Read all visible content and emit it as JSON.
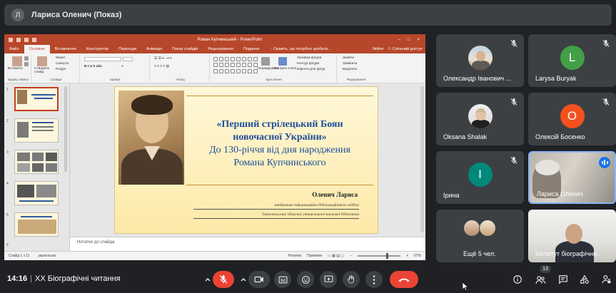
{
  "presenter_bar": {
    "avatar_letter": "Л",
    "title": "Лариса Оленич (Показ)"
  },
  "powerpoint": {
    "window_title": "Роман Купчинський - PowerPoint",
    "tabs": [
      "Файл",
      "Основне",
      "Вставлення",
      "Конструктор",
      "Переходи",
      "Анімація",
      "Показ слайдів",
      "Рецензування",
      "Подання"
    ],
    "active_tab": "Основне",
    "tell_me": "Скажіть, що потрібно зробити...",
    "sign_in": "Увійти",
    "share": "Спільний доступ",
    "ribbon_groups": [
      "Буфер обміну",
      "Слайди",
      "Шрифт",
      "Абзац",
      "Креслення",
      "Редагування"
    ],
    "ribbon_items": {
      "paste": "Вставити",
      "new_slide": "Створити слайд",
      "layout": "Макет",
      "reset": "Скинути",
      "section": "Розділ",
      "arrange": "Упорядкувати",
      "quick_styles": "Експрес-стилі",
      "shape_fill": "Заливка фігури",
      "shape_outline": "Контур фігури",
      "shape_effects": "Ефекти для фігур",
      "find": "Знайти",
      "replace": "Замінити",
      "select": "Виділити"
    },
    "slide_numbers": [
      "1",
      "2",
      "3",
      "4",
      "5",
      "6"
    ],
    "slide": {
      "title_line1": "«Перший стрілецький Боян",
      "title_line2": "новочасної України»",
      "subtitle_line1": "До 130-річчя від дня народження",
      "subtitle_line2": "Романа Купчинського",
      "author": "Оленич Лариса",
      "author_role": "завідувачка інформаційно-бібліографічного відділу",
      "author_org": "Тернопільської обласної універсальної наукової бібліотеки"
    },
    "notes_placeholder": "Нотатки до слайда",
    "status": {
      "slide_counter": "Слайд 1 з 11",
      "language": "українська",
      "notes": "Нотатки",
      "comments": "Примітки",
      "zoom": "67%"
    }
  },
  "participants": [
    {
      "name": "Олександр Іванович ...",
      "type": "photo"
    },
    {
      "name": "Larysa Buryak",
      "letter": "L",
      "color": "#43a047"
    },
    {
      "name": "Oksana Shalak",
      "type": "photo"
    },
    {
      "name": "Олексій Босенко",
      "letter": "О",
      "color": "#f4511e"
    },
    {
      "name": "Ірина",
      "letter": "І",
      "color": "#00897b"
    },
    {
      "name": "Лариса Оленич",
      "type": "camera",
      "speaking": true
    },
    {
      "name": "Ещё 5 чел.",
      "type": "more"
    },
    {
      "name": "Інститут біографічни...",
      "type": "camera"
    }
  ],
  "meeting": {
    "time": "14:16",
    "separator": "|",
    "name": "XX Біографічні читання",
    "participant_count": "13"
  },
  "colors": {
    "accent_red": "#ea4335",
    "pp_brand": "#b7472a",
    "tile_bg": "#3c4043",
    "page_bg": "#202124",
    "speaking": "#1a73e8"
  }
}
